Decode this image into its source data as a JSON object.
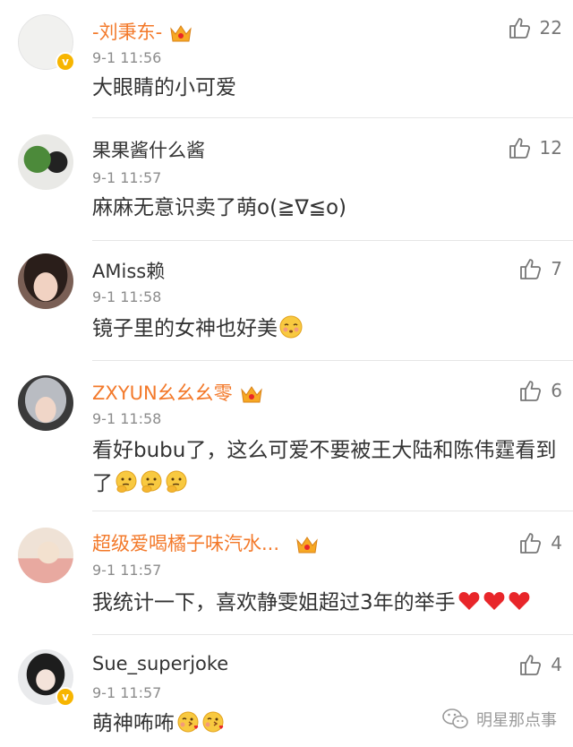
{
  "comments": [
    {
      "name": "-刘秉东-",
      "vip": true,
      "verified": true,
      "time": "9-1 11:56",
      "text": "大眼睛的小可爱",
      "likes": "22",
      "emojis": []
    },
    {
      "name": "果果酱什么酱",
      "vip": false,
      "verified": false,
      "time": "9-1 11:57",
      "text": "麻麻无意识卖了萌o(≧∇≦o)",
      "likes": "12",
      "emojis": []
    },
    {
      "name": "AMiss赖",
      "vip": false,
      "verified": false,
      "time": "9-1 11:58",
      "text": "镜子里的女神也好美",
      "likes": "7",
      "emojis": [
        "shy-face-emoji"
      ]
    },
    {
      "name": "ZXYUN幺幺幺零",
      "vip": true,
      "verified": false,
      "time": "9-1 11:58",
      "text": "看好bubu了，这么可爱不要被王大陆和陈伟霆看到了",
      "likes": "6",
      "emojis": [
        "thinking-face-emoji",
        "thinking-face-emoji",
        "thinking-face-emoji"
      ]
    },
    {
      "name": "超级爱喝橘子味汽水...",
      "vip": true,
      "verified": false,
      "time": "9-1 11:57",
      "text": "我统计一下，喜欢静雯姐超过3年的举手",
      "likes": "4",
      "emojis": [
        "heart-emoji",
        "heart-emoji",
        "heart-emoji"
      ]
    },
    {
      "name": "Sue_superjoke",
      "vip": false,
      "verified": true,
      "time": "9-1 11:57",
      "text": "萌神咘咘",
      "likes": "4",
      "emojis": [
        "kiss-face-emoji",
        "kiss-face-emoji"
      ]
    }
  ],
  "watermark": {
    "text": "明星那点事"
  },
  "colors": {
    "vip_name": "#f3792a",
    "like_icon": "#777777",
    "badge": "#f7b500",
    "heart": "#e8262a"
  }
}
